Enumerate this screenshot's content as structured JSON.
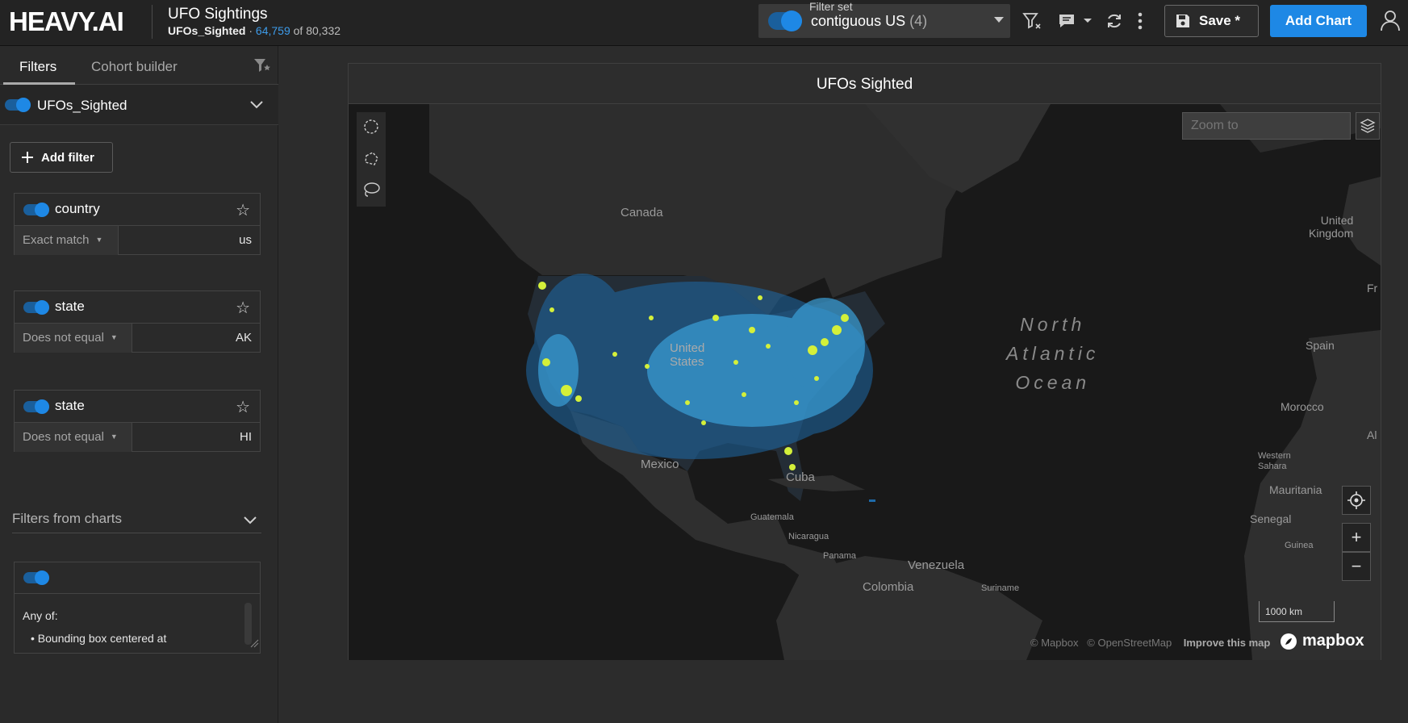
{
  "header": {
    "logo": "HEAVY.AI",
    "dashboard_title": "UFO Sightings",
    "source": "UFOs_Sighted",
    "separator": "·",
    "filtered_count": "64,759",
    "total_text": "of 80,332",
    "filter_set": {
      "label": "Filter set",
      "value": "contiguous US",
      "count": "(4)"
    },
    "save_label": "Save *",
    "add_chart_label": "Add Chart",
    "icons": [
      "filter-clear-icon",
      "comment-icon",
      "caret-down-icon",
      "refresh-icon",
      "more-vertical-icon",
      "user-icon"
    ]
  },
  "sidebar": {
    "tabs": [
      "Filters",
      "Cohort builder"
    ],
    "source_name": "UFOs_Sighted",
    "add_filter_label": "Add filter",
    "filters": [
      {
        "column": "country",
        "operator": "Exact match",
        "value": "us"
      },
      {
        "column": "state",
        "operator": "Does not equal",
        "value": "AK"
      },
      {
        "column": "state",
        "operator": "Does not equal",
        "value": "HI"
      }
    ],
    "filters_from_charts": {
      "title": "Filters from charts",
      "any_of": "Any of:",
      "item": "Bounding box centered at"
    }
  },
  "chart": {
    "title": "UFOs Sighted",
    "zoom_to_placeholder": "Zoom to",
    "scale": "1000 km",
    "attribution": {
      "mapbox": "© Mapbox",
      "osm": "© OpenStreetMap",
      "improve": "Improve this map"
    },
    "mapbox_logo": "mapbox",
    "zoom_in": "+",
    "zoom_out": "−"
  },
  "map_labels": {
    "canada": "Canada",
    "us_line1": "United",
    "us_line2": "States",
    "mexico": "Mexico",
    "cuba": "Cuba",
    "guatemala": "Guatemala",
    "nicaragua": "Nicaragua",
    "panama": "Panama",
    "venezuela": "Venezuela",
    "colombia": "Colombia",
    "suriname": "Suriname",
    "ocean1": "North",
    "ocean2": "Atlantic",
    "ocean3": "Ocean",
    "uk1": "United",
    "uk2": "Kingdom",
    "fr": "Fr",
    "spain": "Spain",
    "morocco": "Morocco",
    "al": "Al",
    "wsahara1": "Western",
    "wsahara2": "Sahara",
    "mauritania": "Mauritania",
    "senegal": "Senegal",
    "guinea": "Guinea"
  }
}
